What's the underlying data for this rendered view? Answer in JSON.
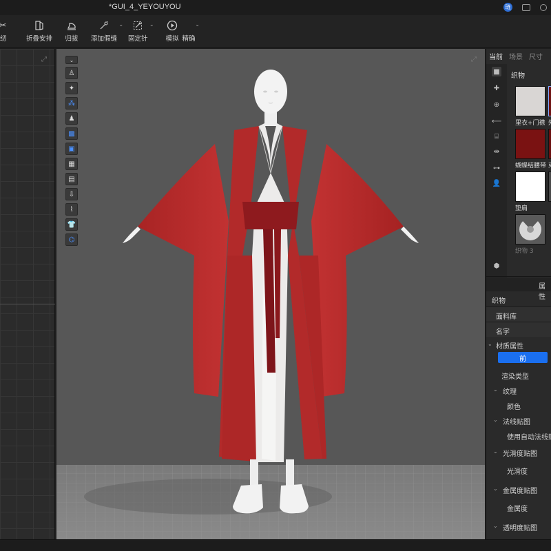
{
  "window": {
    "title": "*GUI_4_YEYOUYOU",
    "badge": "琏"
  },
  "toolbar": {
    "items": [
      {
        "label": "缝纫",
        "icon": "sew-icon"
      },
      {
        "label": "折叠安排",
        "icon": "fold-arrange-icon"
      },
      {
        "label": "归拔",
        "icon": "iron-icon"
      },
      {
        "label": "添加假缝",
        "icon": "tack-add-icon"
      },
      {
        "label": "固定针",
        "icon": "pin-icon"
      },
      {
        "label": "模拟",
        "icon": "simulate-icon"
      },
      {
        "label": "精确",
        "icon": "accurate-icon"
      }
    ]
  },
  "right_panel": {
    "tabs": [
      "当前",
      "场景",
      "尺寸"
    ],
    "active_tab": "当前",
    "section_title": "织物",
    "fabrics": [
      {
        "name": "里衣+门襟",
        "color": "#d9d6d4"
      },
      {
        "name": "外",
        "color": "#6f1414"
      },
      {
        "name": "蝴蝶结腰带",
        "color": "#7a1212"
      },
      {
        "name": "束",
        "color": "#6a1010"
      },
      {
        "name": "垫肩",
        "color": "#ffffff"
      },
      {
        "name": "",
        "color": "#4a4a4a"
      },
      {
        "name": "织物 3",
        "color": "#5a5a5a"
      }
    ],
    "properties_header": "属性",
    "properties": {
      "fabric": "织物",
      "library": "面料库",
      "name": "名字",
      "material": "材质属性",
      "front_button": "前",
      "render_type": "渲染类型",
      "texture": "纹理",
      "color": "颜色",
      "normal_map": "法线贴图",
      "auto_normal": "使用自动法线贴",
      "gloss_map": "光滑度贴图",
      "gloss": "光滑度",
      "metal_map": "金属度贴图",
      "metal": "金属度",
      "opacity_map": "透明度贴图"
    }
  },
  "colors": {
    "garment_red": "#b62a2a",
    "sash_red": "#8e1a1e",
    "inner_white": "#ecebea",
    "accent_blue": "#1a6ff0"
  }
}
